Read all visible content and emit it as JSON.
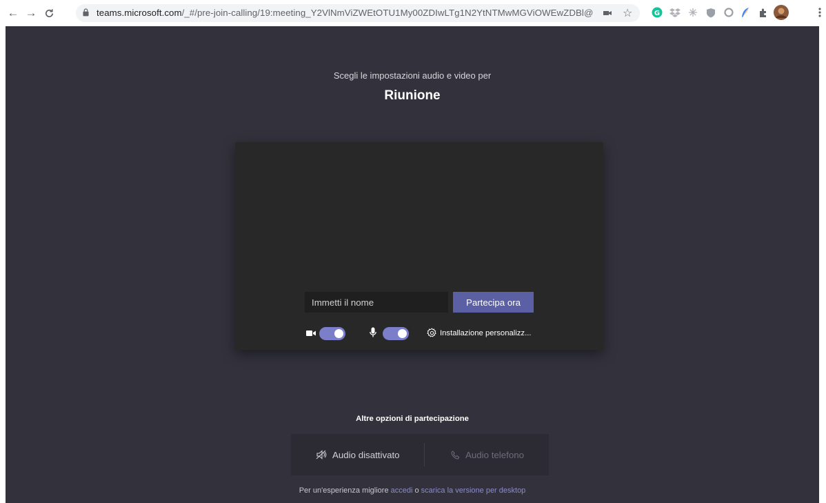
{
  "browser": {
    "url_host": "teams.microsoft.com",
    "url_path": "/_#/pre-join-calling/19:meeting_Y2VlNmViZWEtOTU1My00ZDIwLTg1N2YtNTMwMGViOWEwZDBl@th..."
  },
  "header": {
    "subtitle": "Scegli le impostazioni audio e video per",
    "title": "Riunione"
  },
  "prejoin": {
    "name_placeholder": "Immetti il nome",
    "name_value": "",
    "join_label": "Partecipa ora",
    "camera_on": true,
    "mic_on": true,
    "custom_setup_label": "Installazione personalizz..."
  },
  "other_options": {
    "title": "Altre opzioni di partecipazione",
    "audio_off_label": "Audio disattivato",
    "phone_audio_label": "Audio telefono"
  },
  "footer": {
    "prefix": "Per un'esperienza migliore ",
    "signin_link": "accedi",
    "or": " o ",
    "download_link": "scarica la versione per desktop"
  },
  "colors": {
    "page_bg": "#33323c",
    "accent": "#5b5fa3",
    "toggle_on": "#7b7ec9",
    "link": "#8b8cc7"
  }
}
